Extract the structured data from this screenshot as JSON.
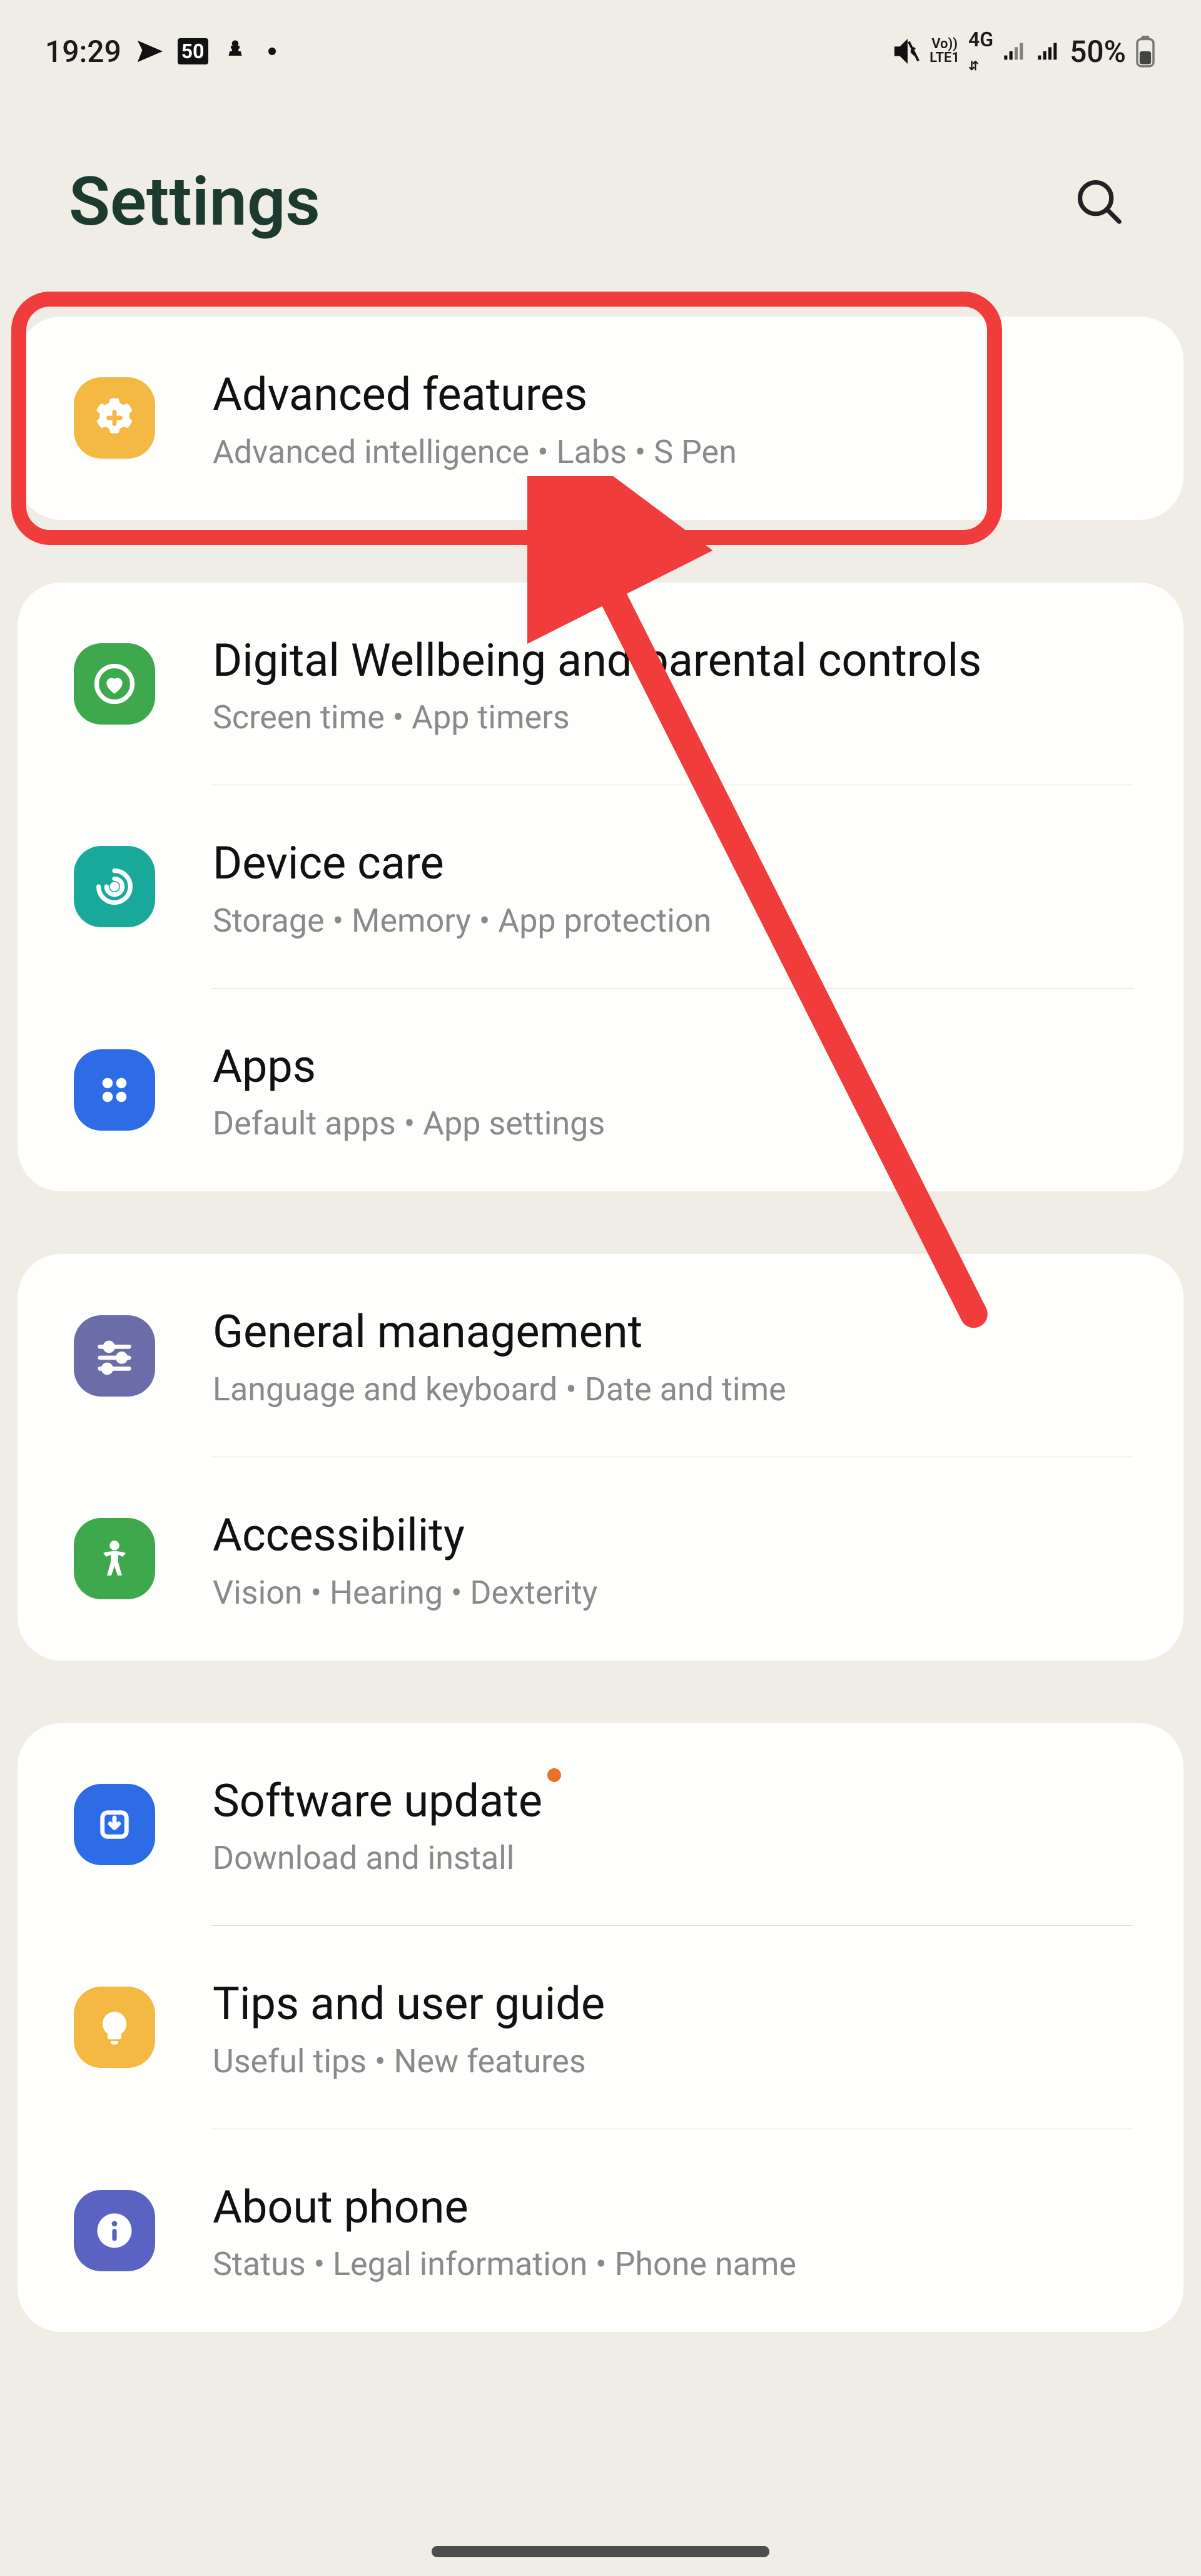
{
  "status": {
    "time": "19:29",
    "battery_pct": "50%",
    "network": "4G",
    "volte": "Vo))\nLTE1"
  },
  "header": {
    "title": "Settings"
  },
  "groups": [
    {
      "items": [
        {
          "key": "advanced-features",
          "icon": "gear-plus-icon",
          "color": "bg-orange",
          "title": "Advanced features",
          "sub": "Advanced intelligence  •  Labs  •  S Pen",
          "highlighted": true
        }
      ]
    },
    {
      "items": [
        {
          "key": "digital-wellbeing",
          "icon": "heart-ring-icon",
          "color": "bg-green",
          "title": "Digital Wellbeing and parental controls",
          "sub": "Screen time  •  App timers"
        },
        {
          "key": "device-care",
          "icon": "spiral-icon",
          "color": "bg-teal",
          "title": "Device care",
          "sub": "Storage  •  Memory  •  App protection"
        },
        {
          "key": "apps",
          "icon": "dots-grid-icon",
          "color": "bg-blue",
          "title": "Apps",
          "sub": "Default apps  •  App settings"
        }
      ]
    },
    {
      "items": [
        {
          "key": "general-management",
          "icon": "sliders-icon",
          "color": "bg-purple",
          "title": "General management",
          "sub": "Language and keyboard  •  Date and time"
        },
        {
          "key": "accessibility",
          "icon": "person-icon",
          "color": "bg-green2",
          "title": "Accessibility",
          "sub": "Vision  •  Hearing  •  Dexterity"
        }
      ]
    },
    {
      "items": [
        {
          "key": "software-update",
          "icon": "download-arrow-icon",
          "color": "bg-blue2",
          "title": "Software update",
          "sub": "Download and install",
          "badge": true
        },
        {
          "key": "tips-guide",
          "icon": "bulb-icon",
          "color": "bg-yellow",
          "title": "Tips and user guide",
          "sub": "Useful tips  •  New features"
        },
        {
          "key": "about-phone",
          "icon": "info-icon",
          "color": "bg-indigo",
          "title": "About phone",
          "sub": "Status  •  Legal information  •  Phone name"
        }
      ]
    }
  ],
  "annotation": {
    "highlight_target": "advanced-features",
    "arrow_tail": "device-care"
  }
}
